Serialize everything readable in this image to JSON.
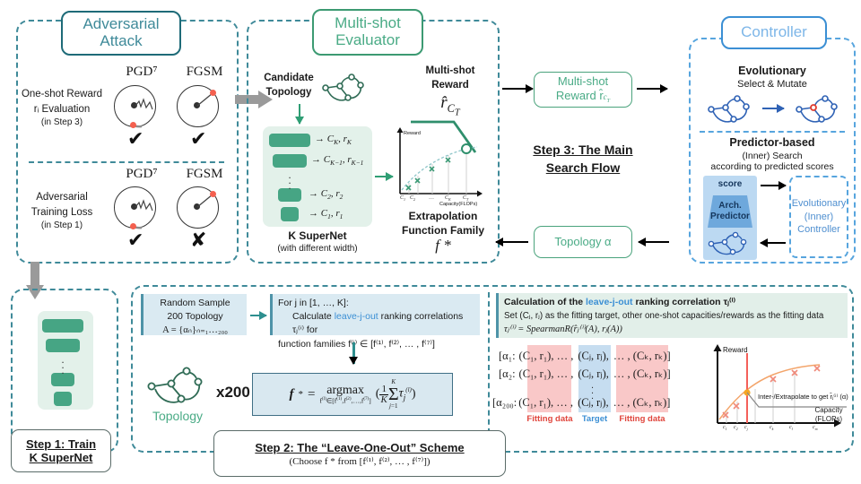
{
  "panels": {
    "adversarial_attack": {
      "title": "Adversarial\nAttack",
      "title_line1": "Adversarial",
      "title_line2": "Attack",
      "row1": {
        "label_line1": "One-shot Reward",
        "label_line2": "rᵢ Evaluation",
        "label_line3": "(in Step 3)",
        "col1": "PGD⁷",
        "col2": "FGSM",
        "col1_mark": "✔",
        "col2_mark": "✔"
      },
      "row2": {
        "label_line1": "Adversarial",
        "label_line2": "Training Loss",
        "label_line3": "(in Step 1)",
        "col1": "PGD⁷",
        "col2": "FGSM",
        "col1_mark": "✔",
        "col2_mark": "✘"
      }
    },
    "multishot_evaluator": {
      "title_line1": "Multi-shot",
      "title_line2": "Evaluator",
      "candidate_topology": "Candidate\nTopology",
      "candidate_topology_l1": "Candidate",
      "candidate_topology_l2": "Topology",
      "supernet_rows": [
        {
          "capacity": "C",
          "sub": "K",
          "reward": "r",
          "reward_sub": "K"
        },
        {
          "capacity": "C",
          "sub": "K−1",
          "reward": "r",
          "reward_sub": "K−1"
        },
        {
          "capacity": "C",
          "sub": "2",
          "reward": "r",
          "reward_sub": "2"
        },
        {
          "capacity": "C",
          "sub": "1",
          "reward": "r",
          "reward_sub": "1"
        }
      ],
      "supernet_caption": "K SuperNet",
      "supernet_subcaption": "(with different width)",
      "multishot_reward_l1": "Multi-shot",
      "multishot_reward_l2": "Reward",
      "reward_symbol": "r̂",
      "reward_symbol_sub": "C_T",
      "extrapolation_l1": "Extrapolation",
      "extrapolation_l2": "Function Family",
      "extrapolation_symbol": "f *"
    },
    "controller": {
      "title": "Controller",
      "evolutionary_title": "Evolutionary",
      "evolutionary_sub": "Select & Mutate",
      "predictor_title": "Predictor-based",
      "predictor_sub1": "(Inner) Search",
      "predictor_sub2": "according to predicted scores",
      "score_label": "score",
      "arch_predictor_l1": "Arch.",
      "arch_predictor_l2": "Predictor",
      "inner_controller_l1": "Evolutionary",
      "inner_controller_l2": "(Inner)",
      "inner_controller_l3": "Controller"
    },
    "main_flow": {
      "step_title_l1": "Step 3: The Main",
      "step_title_l2": "Search Flow",
      "box_reward_l1": "Multi-shot",
      "box_reward_l2": "Reward r̂",
      "box_reward_sub": "c_T",
      "box_topology": "Topology α"
    },
    "step1": {
      "title": "Step 1: Train",
      "subtitle": "K SuperNet"
    },
    "step2": {
      "title": "Step 2: The “Leave-One-Out” Scheme",
      "subtitle": "(Choose f * from [f⁽¹⁾, f⁽²⁾, … , f⁽⁷⁾])",
      "random_sample_l1": "Random Sample",
      "random_sample_l2": "200 Topology",
      "random_sample_l3": "A = {αₙ}ₙ₌₁…₂₀₀",
      "loop_l1": "For j in [1, …, K]:",
      "loop_l2_a": "Calculate ",
      "loop_l2_hl": "leave-j-out",
      "loop_l2_b": " ranking  correlations τⱼ⁽ⁱ⁾ for",
      "loop_l3": "function families f⁽ⁱ⁾ ∈ [f⁽¹⁾, f⁽²⁾, … , f⁽⁷⁾]",
      "topology_label": "Topology",
      "topology_multiplier": "x200",
      "argmax_formula": "f * = argmax (1/K Σⱼ₌₁ᵏ τⱼ⁽ⁱ⁾)",
      "argmax_under": "f⁽ⁱ⁾∈[f⁽¹⁾,f⁽²⁾,…,f⁽⁷⁾]"
    },
    "leave_j_out": {
      "head_a": "Calculation of the ",
      "head_hl": "leave-j-out",
      "head_b": " ranking correlation τⱼ⁽ⁱ⁾",
      "line2": "Set (Cⱼ, rⱼ) as the fitting target, other one-shot capacities/rewards as the fitting data",
      "line3": "τⱼ⁽ⁱ⁾ = SpearmanR(r̂ⱼ⁽ⁱ⁾(A), rⱼ(A))",
      "rows": [
        {
          "prefix": "[α₁:",
          "a": "(C₁, r₁), … ,",
          "b": "(Cⱼ, rⱼ),",
          "c": "… , (Cₖ, rₖ)]"
        },
        {
          "prefix": "[α₂:",
          "a": "(C₁, r₁), … ,",
          "b": "(Cⱼ, rⱼ),",
          "c": "… , (Cₖ, rₖ)]"
        },
        {
          "prefix": "[α₂₀₀:",
          "a": "(C₁, r₁), … ,",
          "b": "(Cⱼ, rⱼ),",
          "c": "… , (Cₖ, rₖ)]"
        }
      ],
      "band_labels": {
        "left": "Fitting data",
        "middle": "Target",
        "right": "Fitting data"
      },
      "annotation": "Inter-/Extrapolate to get  r̂ⱼ⁽ⁱ⁾ (α)"
    }
  },
  "chart_data": [
    {
      "type": "line",
      "id": "extrapolation-curve",
      "title": "",
      "xlabel": "Capacity(FLOPs)",
      "ylabel": "Reward",
      "categories": [
        "C₁",
        "C₂",
        "…",
        "Cₖ",
        "Cₜ"
      ],
      "x": [
        0.1,
        0.2,
        0.4,
        0.62,
        0.86
      ],
      "values": [
        0.28,
        0.45,
        0.66,
        0.8,
        0.88
      ],
      "marker": "x",
      "target_point": {
        "x": 0.86,
        "y": 0.88,
        "marker": "o",
        "label": "r̂_C_T"
      },
      "grid": true,
      "legend": "none"
    },
    {
      "type": "scatter",
      "id": "leave-j-out-curve",
      "title": "",
      "xlabel": "Capacity\n(FLOPs)",
      "ylabel": "Reward",
      "categories": [
        "c₁",
        "c₂",
        "cⱼ",
        "cₖ",
        "cₗ",
        "cₘ"
      ],
      "x": [
        0.08,
        0.18,
        0.3,
        0.46,
        0.62,
        0.82
      ],
      "values": [
        0.25,
        0.42,
        0.58,
        0.7,
        0.78,
        0.84
      ],
      "marker": "x",
      "highlight_index": 2,
      "highlight_color": "#f5a623",
      "vline_x": 0.3,
      "vline_color": "#f4605a",
      "curve_color": "#f3a46a",
      "grid": true,
      "legend": "none"
    }
  ],
  "colors": {
    "teal": "#3f8a99",
    "teal_dark": "#1e6b78",
    "green": "#4aab86",
    "green_dark": "#3c9a72",
    "blue": "#57a5de",
    "blue_dark": "#3b8fd4",
    "red_dot": "#f4604f",
    "supernet_bar": "#46a584",
    "pink_band": "#f9c8c8",
    "blue_band": "#c6ddf0",
    "infobox_bg": "#daeaf2"
  }
}
